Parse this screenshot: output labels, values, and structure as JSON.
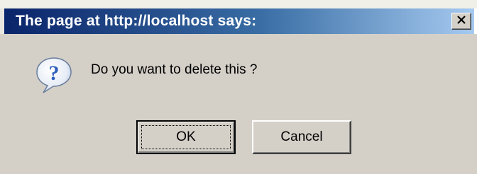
{
  "dialog": {
    "title": "The page at http://localhost says:",
    "message": "Do you want to delete this ?",
    "close_icon": "close-icon",
    "message_icon": "question-icon",
    "buttons": {
      "ok_label": "OK",
      "cancel_label": "Cancel"
    }
  },
  "colors": {
    "titlebar_start": "#0a246a",
    "titlebar_end": "#a6caf0",
    "dialog_face": "#d4d0c8",
    "icon_fill": "#3b6cc8"
  }
}
